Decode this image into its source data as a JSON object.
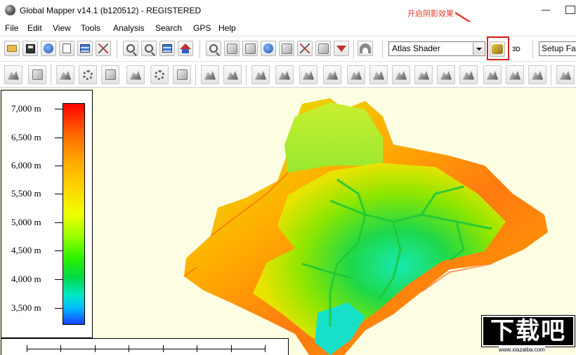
{
  "window": {
    "title": "Global Mapper v14.1 (b120512) - REGISTERED"
  },
  "menu": [
    "File",
    "Edit",
    "View",
    "Tools",
    "Analysis",
    "Search",
    "GPS",
    "Help"
  ],
  "annotation": {
    "text": "开启阴影效果",
    "color": "#e8382a"
  },
  "toolbar": {
    "shader_value": "Atlas Shader",
    "setup_favorites": "Setup Fav",
    "highlighted_button": "shader-toggle-button",
    "row1_icons": [
      "open-folder-icon",
      "save-icon",
      "globe-icon",
      "document-icon",
      "layers-icon",
      "tools-icon",
      "zoom-in-icon",
      "zoom-out-icon",
      "zoom-full-icon",
      "home-icon",
      "zoom-rect-icon",
      "pan-icon",
      "measure-icon",
      "info-icon",
      "pick-icon",
      "tower-icon",
      "path-icon",
      "dropdown-arrow-icon",
      "arch-icon",
      "shader-icon",
      "3d-view-icon"
    ],
    "row2_icons": [
      "digitize-icon",
      "edit-vertex-icon",
      "line-icon",
      "area-icon",
      "feature-icon",
      "move-icon",
      "rotate-icon",
      "grid-icon",
      "point-icon",
      "split-icon",
      "terrain-edit-icon",
      "terrain-smooth-icon",
      "terrain-lower-icon",
      "path-profile-icon",
      "view-shed-icon",
      "terrain-a-icon",
      "terrain-b-icon",
      "terrain-c-icon",
      "terrain-d-icon",
      "terrain-e-icon",
      "terrain-f-icon",
      "terrain-g-icon",
      "terrain-h-icon",
      "terrain-i-icon"
    ]
  },
  "legend": {
    "labels": [
      "7,000 m",
      "6,500 m",
      "6,000 m",
      "5,500 m",
      "5,000 m",
      "4,500 m",
      "4,000 m",
      "3,500 m"
    ]
  },
  "watermark": {
    "text": "下载吧",
    "url": "www.xiazaiba.com"
  },
  "colors": {
    "map_background": "#fefee2",
    "highlight": "#d92020"
  }
}
